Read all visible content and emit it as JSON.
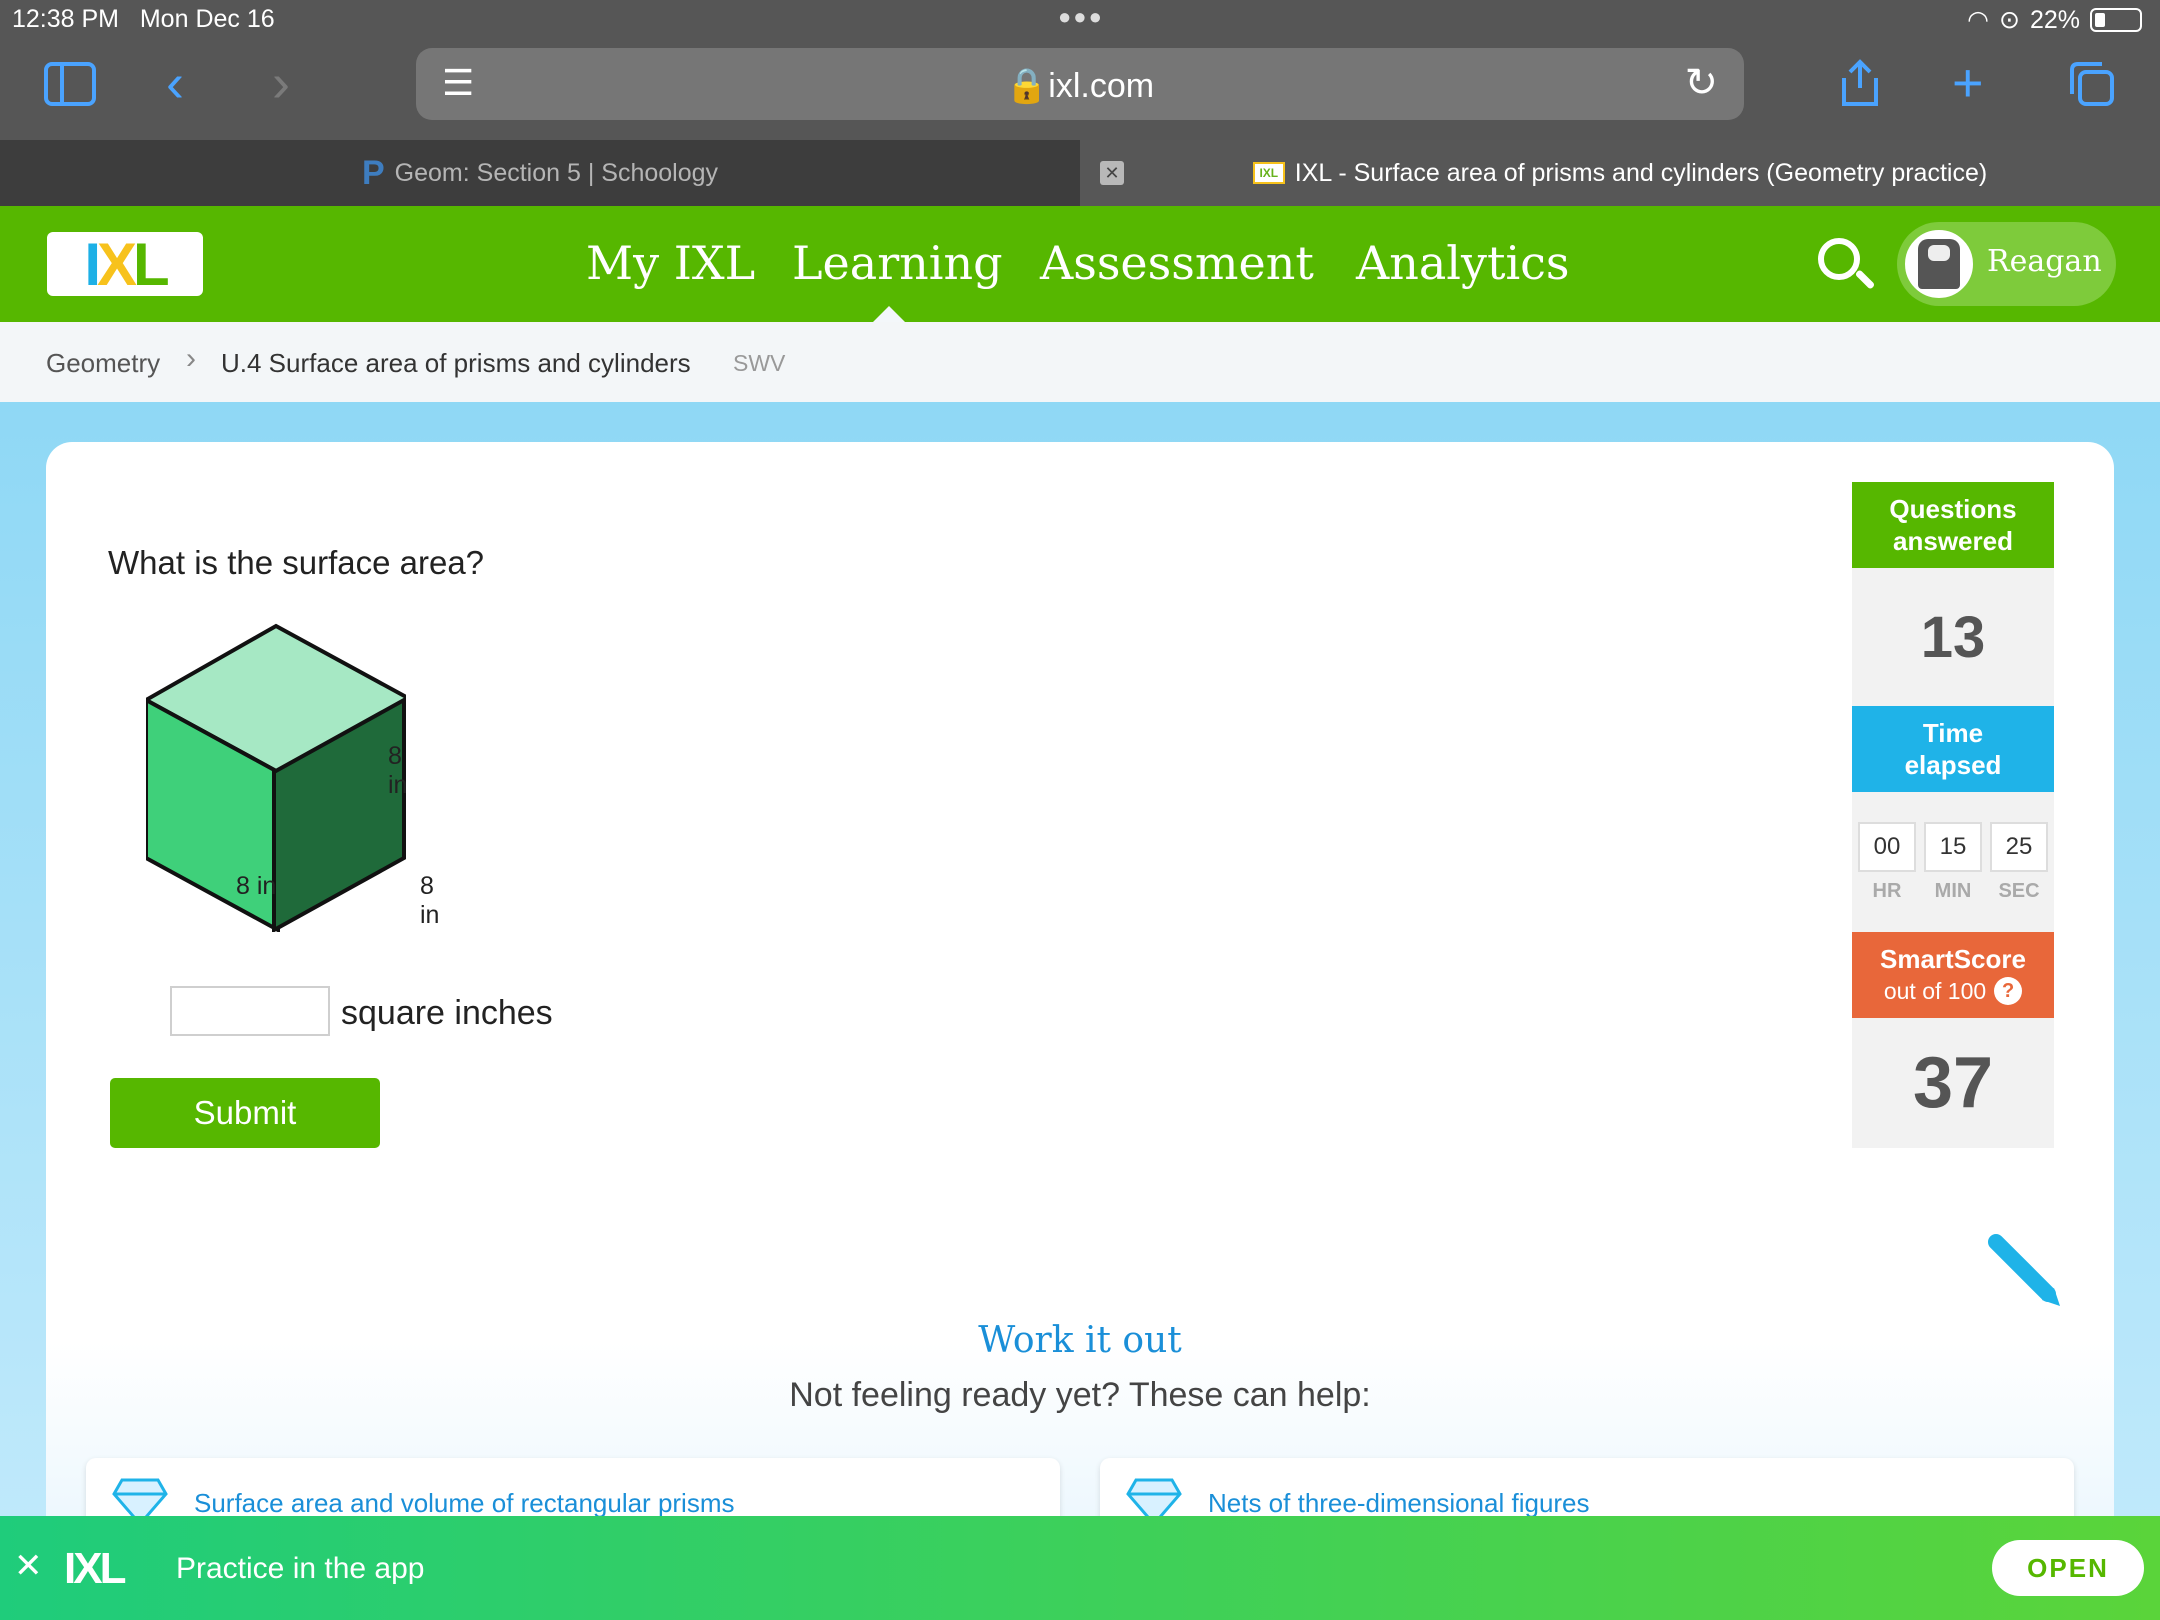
{
  "status": {
    "time": "12:38 PM",
    "date": "Mon Dec 16",
    "battery": "22%"
  },
  "browser": {
    "url": "ixl.com",
    "tabs": [
      {
        "label": "Geom: Section 5 | Schoology"
      },
      {
        "label": "IXL - Surface area of prisms and cylinders (Geometry practice)"
      }
    ]
  },
  "nav": {
    "logo": "IXL",
    "items": [
      "My IXL",
      "Learning",
      "Assessment",
      "Analytics"
    ],
    "active": "Learning",
    "user": "Reagan"
  },
  "breadcrumb": {
    "subject": "Geometry",
    "skill": "U.4 Surface area of prisms and cylinders",
    "code": "SWV"
  },
  "question": {
    "prompt": "What is the surface area?",
    "labels": {
      "height": "8 in",
      "left": "8 in",
      "right": "8 in"
    },
    "answer_value": "",
    "unit": "square inches",
    "submit": "Submit"
  },
  "stats": {
    "answered_label_1": "Questions",
    "answered_label_2": "answered",
    "answered": "13",
    "time_label_1": "Time",
    "time_label_2": "elapsed",
    "hr": "00",
    "min": "15",
    "sec": "25",
    "hr_label": "HR",
    "min_label": "MIN",
    "sec_label": "SEC",
    "score_label": "SmartScore",
    "score_sub": "out of 100",
    "score": "37"
  },
  "help": {
    "title": "Work it out",
    "subtitle": "Not feeling ready yet? These can help:",
    "links": [
      "Surface area and volume of rectangular prisms",
      "Nets of three-dimensional figures"
    ]
  },
  "banner": {
    "logo": "IXL",
    "text": "Practice in the app",
    "button": "OPEN"
  },
  "colors": {
    "brand_green": "#56b700",
    "time_blue": "#1fb3e8",
    "score_orange": "#e8673a"
  }
}
